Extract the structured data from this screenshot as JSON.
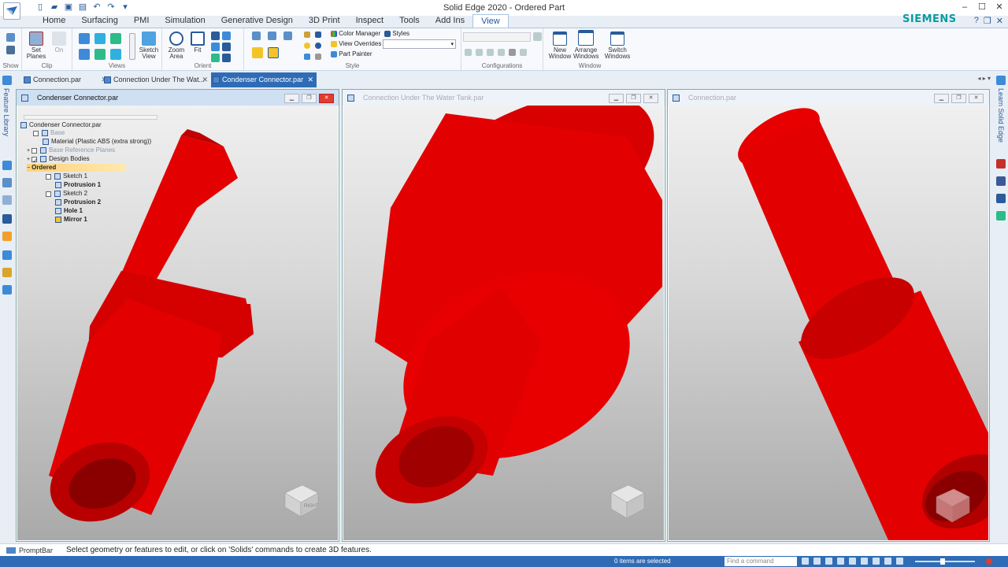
{
  "window": {
    "title": "Solid Edge 2020 - Ordered Part",
    "brand": "SIEMENS",
    "controls": [
      "–",
      "☐",
      "✕"
    ]
  },
  "ribbon": {
    "tabs": [
      "Home",
      "Surfacing",
      "PMI",
      "Simulation",
      "Generative Design",
      "3D Print",
      "Inspect",
      "Tools",
      "Add Ins",
      "View"
    ],
    "active_tab": "View",
    "groups": {
      "show": "Show",
      "clip": "Clip",
      "views": "Views",
      "orient": "Orient",
      "style": "Style",
      "configurations": "Configurations",
      "window": "Window"
    },
    "buttons": {
      "set_planes_1": "Set",
      "set_planes_2": "Planes",
      "on": "On",
      "sketch_view_1": "Sketch",
      "sketch_view_2": "View",
      "zoom_area_1": "Zoom",
      "zoom_area_2": "Area",
      "fit": "Fit",
      "color_manager": "Color Manager",
      "styles": "Styles",
      "view_overrides": "View Overrides",
      "part_painter": "Part Painter",
      "new_window_1": "New",
      "new_window_2": "Window",
      "arrange_1": "Arrange",
      "arrange_2": "Windows",
      "switch_windows_1": "Switch",
      "switch_windows_2": "Windows"
    }
  },
  "doc_tabs": [
    {
      "label": "Connection.par",
      "active": false
    },
    {
      "label": "Connection Under The Wat...",
      "active": false
    },
    {
      "label": "Condenser Connector.par",
      "active": true
    }
  ],
  "side": {
    "left_label": "Feature Library",
    "right_label": "Learn Solid Edge"
  },
  "panes": [
    {
      "title": "Condenser Connector.par",
      "active": true
    },
    {
      "title": "Connection Under The Water Tank.par",
      "active": false
    },
    {
      "title": "Connection.par",
      "active": false
    }
  ],
  "tree": {
    "root": "Condenser Connector.par",
    "nodes": [
      {
        "label": "Base",
        "faded": true
      },
      {
        "label": "Material (Plastic ABS (extra strong))"
      },
      {
        "label": "Base Reference Planes",
        "faded": true
      },
      {
        "label": "Design Bodies"
      },
      {
        "label": "Ordered",
        "selected": true
      },
      {
        "label": "Sketch 1"
      },
      {
        "label": "Protrusion 1",
        "bold": true
      },
      {
        "label": "Sketch 2"
      },
      {
        "label": "Protrusion 2",
        "bold": true
      },
      {
        "label": "Hole 1",
        "bold": true
      },
      {
        "label": "Mirror 1",
        "bold": true
      }
    ]
  },
  "model_color": "#e00000",
  "prompt": {
    "label": "PromptBar",
    "message": "Select geometry or features to edit, or click on 'Solids' commands to create 3D features."
  },
  "status": {
    "selection": "0 items are selected",
    "find_placeholder": "Find a command"
  },
  "view_cube_label": "RIGHT"
}
